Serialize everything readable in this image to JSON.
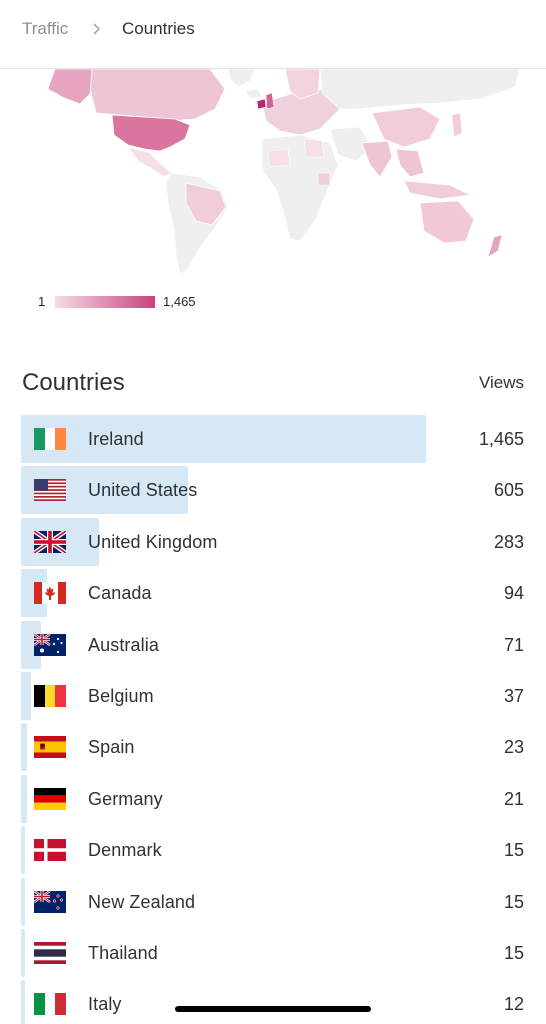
{
  "breadcrumb": {
    "parent": "Traffic",
    "current": "Countries"
  },
  "legend": {
    "min": "1",
    "max": "1,465",
    "color_low": "#f4dce6",
    "color_high": "#c9437f"
  },
  "section": {
    "title": "Countries",
    "views_header": "Views"
  },
  "bar_color": "#d6e7f5",
  "countries": [
    {
      "name": "Ireland",
      "views": "1,465",
      "value": 1465,
      "flag": "ireland-flag-icon"
    },
    {
      "name": "United States",
      "views": "605",
      "value": 605,
      "flag": "usa-flag-icon"
    },
    {
      "name": "United Kingdom",
      "views": "283",
      "value": 283,
      "flag": "uk-flag-icon"
    },
    {
      "name": "Canada",
      "views": "94",
      "value": 94,
      "flag": "canada-flag-icon"
    },
    {
      "name": "Australia",
      "views": "71",
      "value": 71,
      "flag": "australia-flag-icon"
    },
    {
      "name": "Belgium",
      "views": "37",
      "value": 37,
      "flag": "belgium-flag-icon"
    },
    {
      "name": "Spain",
      "views": "23",
      "value": 23,
      "flag": "spain-flag-icon"
    },
    {
      "name": "Germany",
      "views": "21",
      "value": 21,
      "flag": "germany-flag-icon"
    },
    {
      "name": "Denmark",
      "views": "15",
      "value": 15,
      "flag": "denmark-flag-icon"
    },
    {
      "name": "New Zealand",
      "views": "15",
      "value": 15,
      "flag": "new-zealand-flag-icon"
    },
    {
      "name": "Thailand",
      "views": "15",
      "value": 15,
      "flag": "thailand-flag-icon"
    },
    {
      "name": "Italy",
      "views": "12",
      "value": 12,
      "flag": "italy-flag-icon"
    }
  ]
}
